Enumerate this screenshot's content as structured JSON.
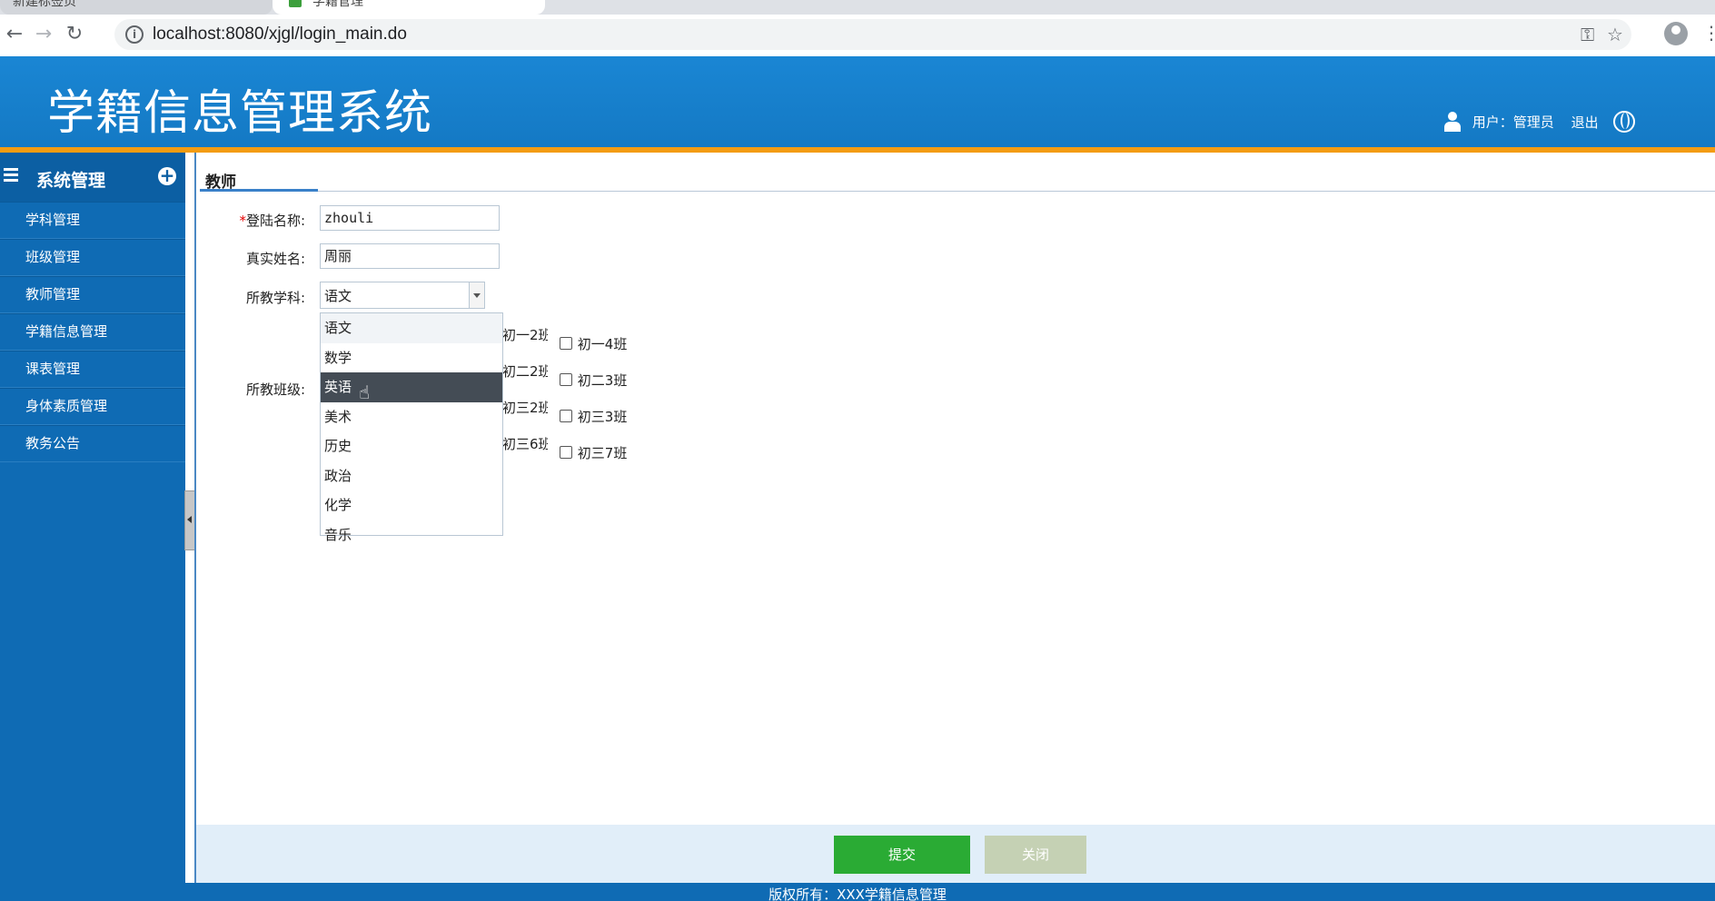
{
  "browser": {
    "tabs": [
      {
        "label": "新建标签页"
      },
      {
        "label": "学籍管理"
      }
    ],
    "url": "localhost:8080/xjgl/login_main.do"
  },
  "header": {
    "title": "学籍信息管理系统",
    "user_label": "用户：管理员",
    "logout_label": "退出"
  },
  "sidebar": {
    "title": "系统管理",
    "items": [
      {
        "label": "学科管理"
      },
      {
        "label": "班级管理"
      },
      {
        "label": "教师管理"
      },
      {
        "label": "学籍信息管理"
      },
      {
        "label": "课表管理"
      },
      {
        "label": "身体素质管理"
      },
      {
        "label": "教务公告"
      }
    ]
  },
  "main": {
    "tab_label": "教师",
    "form": {
      "login_name_label": "登陆名称:",
      "login_name_required": "*",
      "login_name_value": "zhouli",
      "real_name_label": "真实姓名:",
      "real_name_value": "周丽",
      "subject_label": "所教学科:",
      "subject_value": "语文",
      "subject_options": [
        "语文",
        "数学",
        "英语",
        "美术",
        "历史",
        "政治",
        "化学",
        "音乐"
      ],
      "hovered_option": "英语",
      "classes_label": "所教班级:",
      "class_rows": [
        {
          "partial": "初一2班",
          "full": "初一4班"
        },
        {
          "partial": "初二2班",
          "full": "初二3班"
        },
        {
          "partial": "初三2班",
          "full": "初三3班"
        },
        {
          "partial": "初三6班",
          "full": "初三7班"
        }
      ]
    },
    "buttons": {
      "submit": "提交",
      "close": "关闭"
    }
  },
  "footer": {
    "copyright": "版权所有：XXX学籍信息管理"
  }
}
